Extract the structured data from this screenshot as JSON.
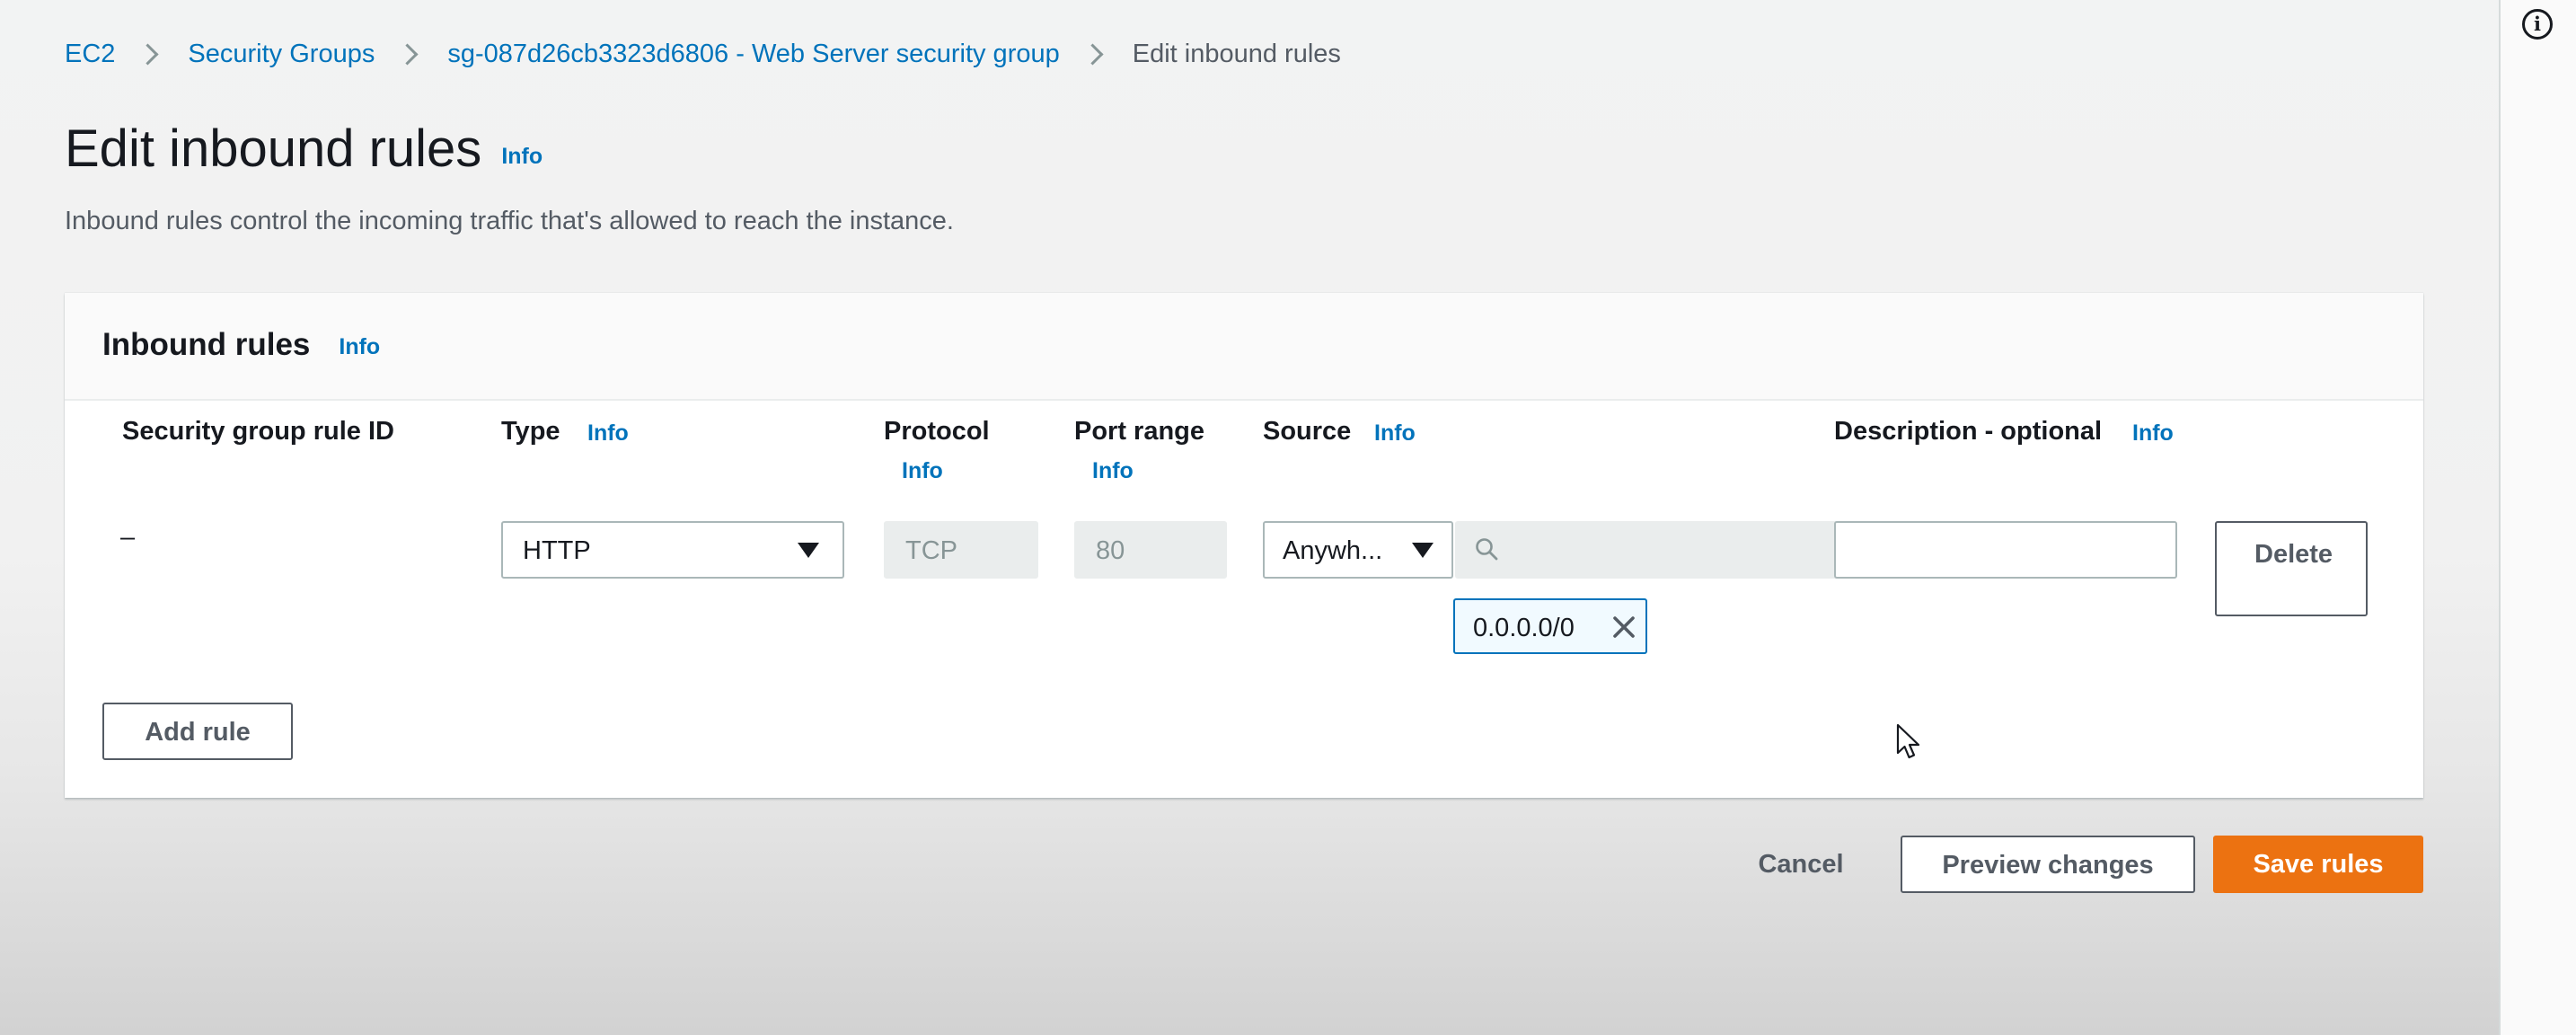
{
  "colors": {
    "link": "#0073bb",
    "primary_button": "#ec7211",
    "token_border": "#0073bb",
    "token_background": "#f1faff",
    "disabled_field": "#eaeded"
  },
  "breadcrumb": {
    "items": [
      "EC2",
      "Security Groups",
      "sg-087d26cb3323d6806 - Web Server security group"
    ],
    "current": "Edit inbound rules",
    "separator_icon": "chevron-right-icon"
  },
  "header": {
    "title": "Edit inbound rules",
    "info_label": "Info",
    "description": "Inbound rules control the incoming traffic that's allowed to reach the instance."
  },
  "panel": {
    "title": "Inbound rules",
    "info_label": "Info",
    "columns": {
      "rule_id": "Security group rule ID",
      "type": "Type",
      "type_info": "Info",
      "protocol": "Protocol",
      "protocol_info": "Info",
      "port_range": "Port range",
      "port_range_info": "Info",
      "source": "Source",
      "source_info": "Info",
      "description": "Description - optional",
      "description_info": "Info"
    },
    "rules": [
      {
        "rule_id": "–",
        "type": "HTTP",
        "protocol": "TCP",
        "port_range": "80",
        "source": "Anywh...",
        "source_search_value": "",
        "cidr_tokens": [
          "0.0.0.0/0"
        ],
        "description": "",
        "delete_label": "Delete"
      }
    ],
    "add_rule_label": "Add rule"
  },
  "footer": {
    "cancel_label": "Cancel",
    "preview_label": "Preview changes",
    "save_label": "Save rules"
  },
  "icons": {
    "dropdown": "caret-down-icon",
    "search": "search-icon",
    "remove": "close-icon",
    "help_panel": "info-circle-icon"
  }
}
